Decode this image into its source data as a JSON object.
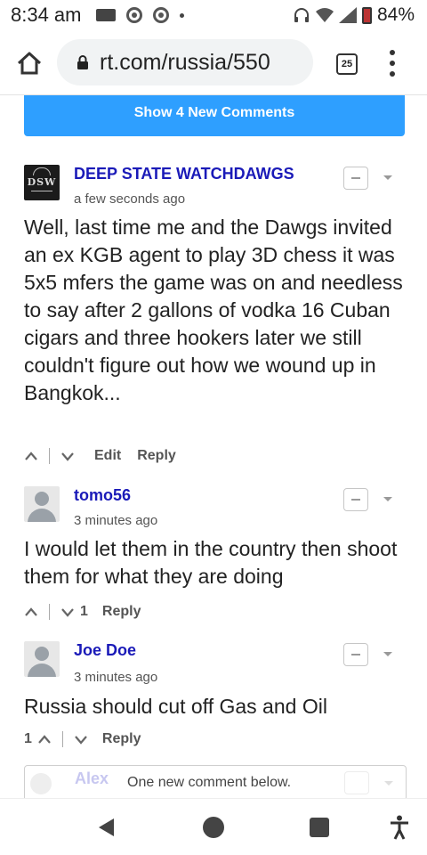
{
  "status_bar": {
    "time": "8:34 am",
    "battery": "84%",
    "icons": [
      "mail-icon",
      "chrome-icon",
      "chrome-icon",
      "dot-icon",
      "headphones-icon",
      "wifi-icon",
      "signal-icon",
      "battery-icon"
    ]
  },
  "browser": {
    "url": "rt.com/russia/550",
    "tab_count": "25"
  },
  "comments_section": {
    "new_comments_button": "Show 4 New Comments",
    "comments": [
      {
        "author": "DEEP STATE WATCHDAWGS",
        "avatar_text": "DSW",
        "time": "a few seconds ago",
        "body": "Well, last time me and the Dawgs invited an ex KGB agent to play 3D chess it was 5x5 mfers the game was on and needless to say after 2 gallons of vodka 16 Cuban cigars and three hookers later we still couldn't figure out how we wound up in Bangkok...",
        "edit": "Edit",
        "reply": "Reply"
      },
      {
        "author": "tomo56",
        "time": "3 minutes ago",
        "body": "I would let them in the country then shoot them for what they are doing",
        "downvotes": "1",
        "reply": "Reply"
      },
      {
        "author": "Joe Doe",
        "time": "3 minutes ago",
        "body": "Russia should cut off Gas and Oil",
        "upvotes": "1",
        "reply": "Reply"
      }
    ],
    "notice": {
      "ghost_author": "Alex",
      "text": "One new comment below."
    }
  },
  "colors": {
    "accent": "#2e9fff",
    "author_link": "#1a1ab8"
  }
}
